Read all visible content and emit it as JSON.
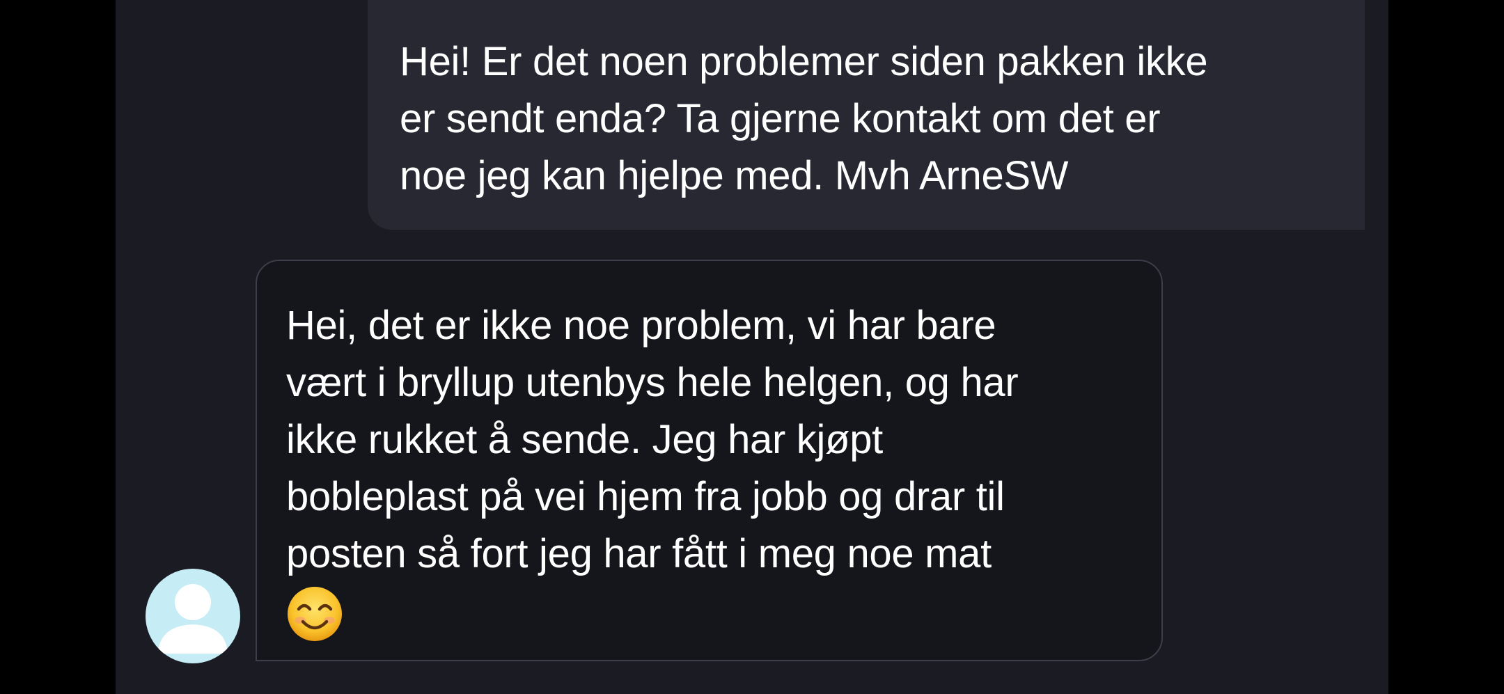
{
  "conversation": {
    "messages": [
      {
        "sender": "me",
        "text": "Hei! Er det noen problemer siden pakken ikke\ner sendt enda? Ta gjerne kontakt om det er\nnoe jeg kan hjelpe med. Mvh ArneSW"
      },
      {
        "sender": "other",
        "text": "Hei, det er ikke noe problem, vi har bare\nvært i bryllup utenbys hele helgen, og har\nikke rukket å sende. Jeg har kjøpt\nbobleplast på vei hjem fra jobb og drar til\nposten så fort jeg har fått i meg noe mat",
        "emoji": "smiling-face-emoji"
      }
    ],
    "avatar": {
      "icon": "default-user-avatar",
      "color": "#c6ecf6"
    }
  },
  "colors": {
    "background": "#1b1b23",
    "outgoing_bubble": "#282832",
    "incoming_bubble": "#15151c",
    "incoming_border": "#3e3e4a",
    "text": "#ffffff"
  }
}
